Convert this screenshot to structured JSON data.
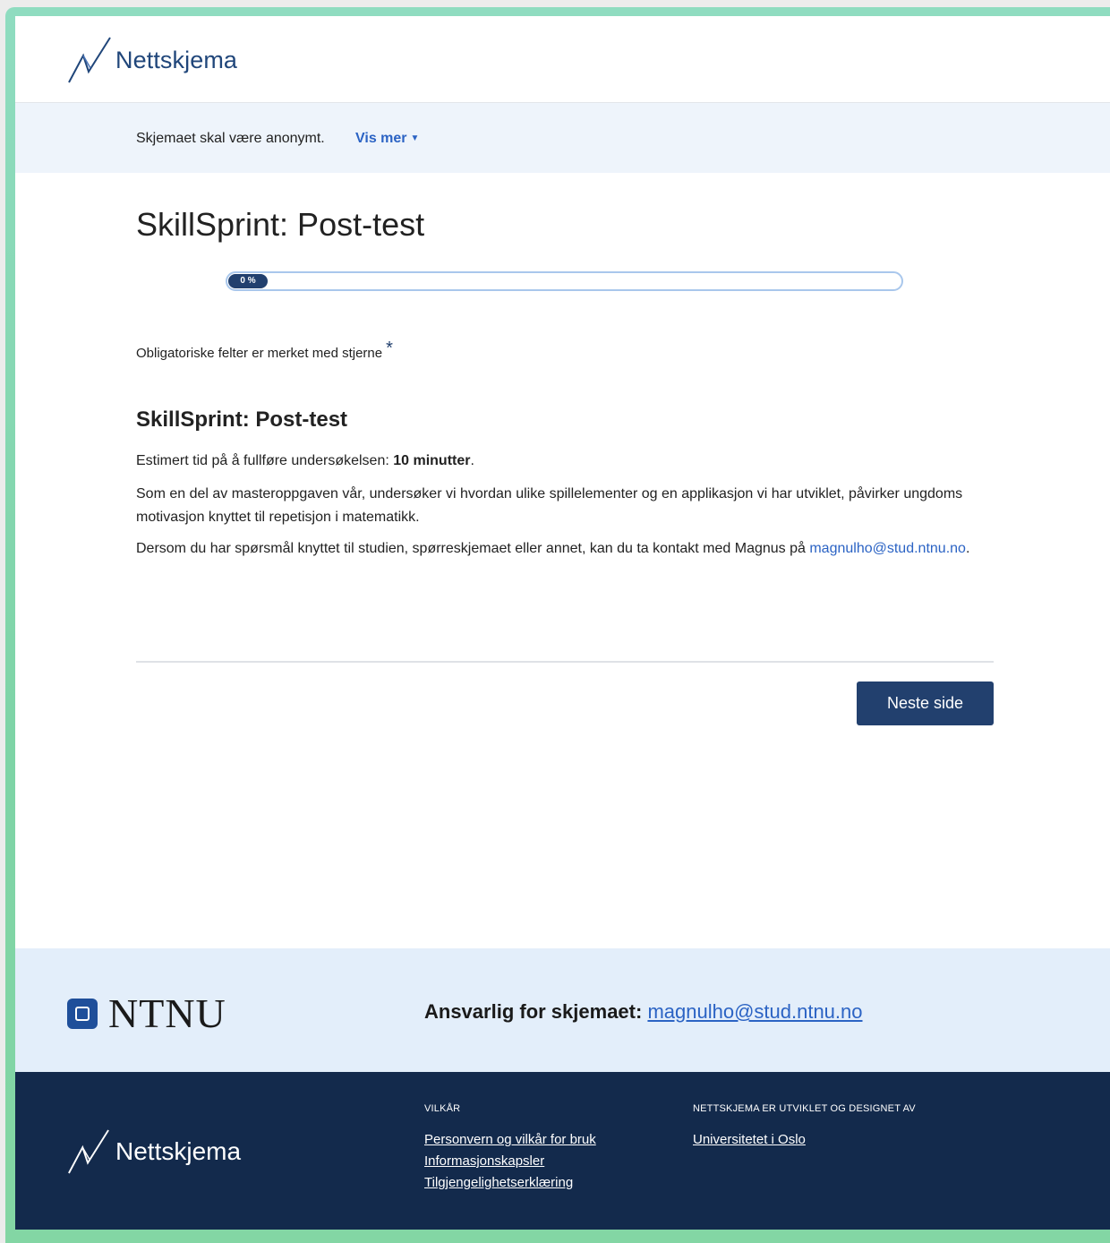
{
  "header": {
    "logo_text": "Nettskjema"
  },
  "notice": {
    "text": "Skjemaet skal være anonymt.",
    "more_label": "Vis mer"
  },
  "main": {
    "title": "SkillSprint: Post-test",
    "progress": {
      "value": 0,
      "label": "0 %"
    },
    "mandatory_text": "Obligatoriske felter er merket med stjerne",
    "mandatory_star": "*",
    "section_title": "SkillSprint: Post-test",
    "estimate_prefix": "Estimert tid på å fullføre undersøkelsen: ",
    "estimate_value": "10 minutter",
    "estimate_suffix": ".",
    "paragraph2": "Som en del av masteroppgaven vår, undersøker vi hvordan ulike spillelementer og en applikasjon vi har utviklet, påvirker ungdoms motivasjon knyttet til repetisjon i matematikk.",
    "paragraph3_text": "Dersom du har spørsmål knyttet til studien, spørreskjemaet eller annet, kan du ta kontakt med Magnus på ",
    "paragraph3_link": "magnulho@stud.ntnu.no",
    "paragraph3_suffix": ".",
    "next_button": "Neste side"
  },
  "footer_top": {
    "org_name": "NTNU",
    "responsible_label": "Ansvarlig for skjemaet:",
    "responsible_email": "magnulho@stud.ntnu.no"
  },
  "footer_bottom": {
    "logo_text": "Nettskjema",
    "terms_heading": "VILKÅR",
    "terms_links": [
      "Personvern og vilkår for bruk",
      "Informasjonskapsler",
      "Tilgjengelighetserklæring"
    ],
    "dev_heading": "NETTSKJEMA ER UTVIKLET OG DESIGNET AV",
    "dev_link": "Universitetet i Oslo"
  },
  "colors": {
    "primary_navy": "#22406e",
    "link_blue": "#2b63c4",
    "footer_dark": "#132a4c",
    "notice_bg": "#eef4fb"
  }
}
